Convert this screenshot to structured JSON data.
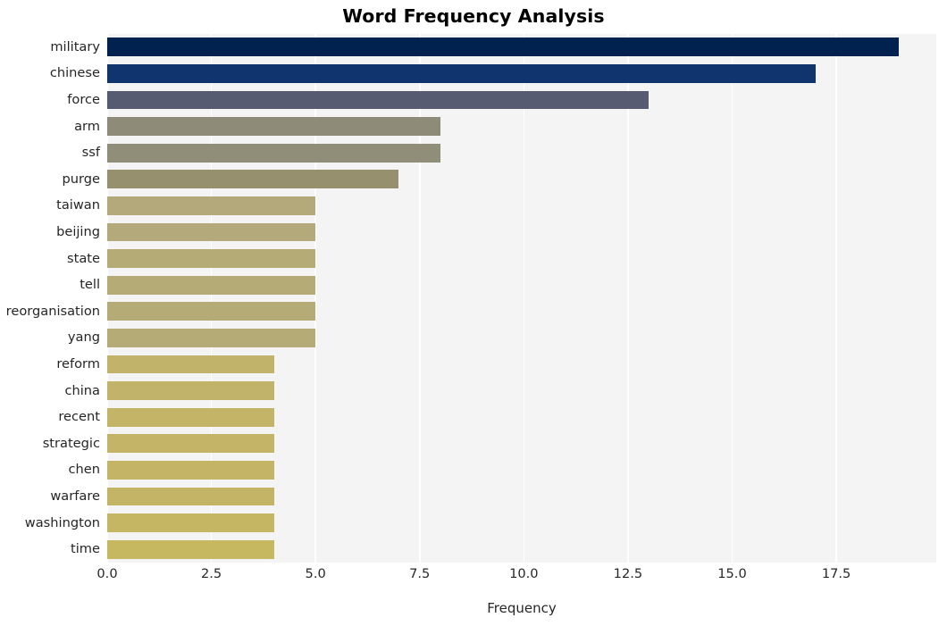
{
  "chart_data": {
    "type": "bar",
    "orientation": "horizontal",
    "title": "Word Frequency Analysis",
    "xlabel": "Frequency",
    "ylabel": "",
    "xlim": [
      0,
      19.9
    ],
    "xticks": [
      "0.0",
      "2.5",
      "5.0",
      "7.5",
      "10.0",
      "12.5",
      "15.0",
      "17.5"
    ],
    "xtick_values": [
      0,
      2.5,
      5,
      7.5,
      10,
      12.5,
      15,
      17.5
    ],
    "grid": "vertical",
    "legend": "none",
    "categories": [
      "military",
      "chinese",
      "force",
      "arm",
      "ssf",
      "purge",
      "taiwan",
      "beijing",
      "state",
      "tell",
      "reorganisation",
      "yang",
      "reform",
      "china",
      "recent",
      "strategic",
      "chen",
      "warfare",
      "washington",
      "time"
    ],
    "values": [
      19,
      17,
      13,
      8,
      8,
      7,
      5,
      5,
      5,
      5,
      5,
      5,
      4,
      4,
      4,
      4,
      4,
      4,
      4,
      4
    ],
    "bar_colors": [
      "#01224e",
      "#10346e",
      "#565b72",
      "#8e8b78",
      "#908d79",
      "#96906f",
      "#b3a97a",
      "#b3a97a",
      "#b5ab77",
      "#b5ab77",
      "#b5ab77",
      "#b5ab77",
      "#c2b36a",
      "#c2b36a",
      "#c3b468",
      "#c3b468",
      "#c4b566",
      "#c4b566",
      "#c5b663",
      "#c6b761"
    ]
  },
  "style": {
    "figure_background": "#ffffff",
    "plot_background": "#f4f4f4",
    "gridline_color": "#ffffff",
    "tick_label_color": "#262626",
    "title_color": "#000000"
  }
}
